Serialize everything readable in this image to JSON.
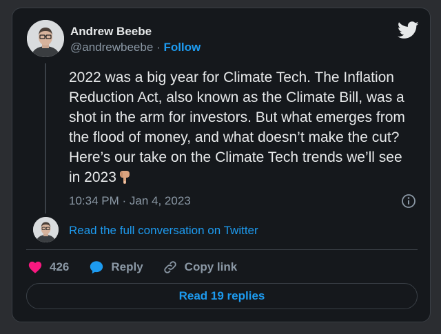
{
  "author": {
    "name": "Andrew Beebe",
    "handle": "@andrewbeebe",
    "separator": "·",
    "follow_label": "Follow"
  },
  "tweet": {
    "text": "2022 was a big year for Climate Tech. The Inflation Reduction Act, also known as the Climate Bill, was a shot in the arm for investors. But what emerges from the flood of money, and what doesn’t make the cut? Here’s our take on the Climate Tech trends we’ll see in 2023",
    "emoji_icon": "backhand-index-pointing-down",
    "timestamp": "10:34 PM · Jan 4, 2023"
  },
  "conversation": {
    "link_label": "Read the full conversation on Twitter"
  },
  "actions": {
    "like_count": "426",
    "reply_label": "Reply",
    "copy_link_label": "Copy link"
  },
  "footer": {
    "replies_button_label": "Read 19 replies"
  },
  "colors": {
    "background": "#15181c",
    "accent": "#1d9bf0",
    "like": "#f91880",
    "muted_text": "#8b98a5"
  }
}
